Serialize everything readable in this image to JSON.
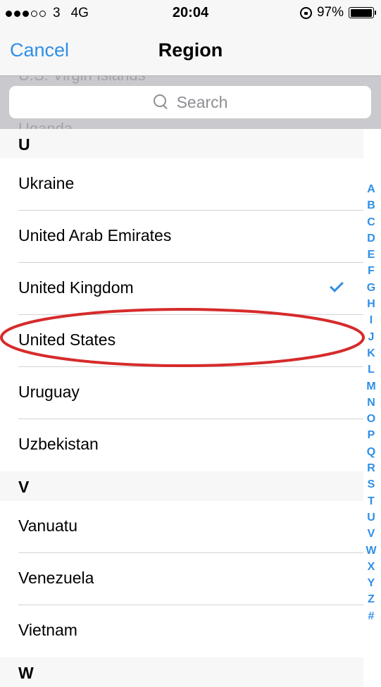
{
  "status_bar": {
    "carrier": "3",
    "network": "4G",
    "time": "20:04",
    "battery": "97%",
    "battery_level": 0.97,
    "signal": {
      "filled": 3,
      "total": 5
    }
  },
  "nav": {
    "cancel_label": "Cancel",
    "title": "Region"
  },
  "search": {
    "placeholder": "Search",
    "ghost_above": "U.S. Virgin Islands",
    "ghost_below": "Uganda"
  },
  "sections": [
    {
      "letter": "U",
      "items": [
        "Ukraine",
        "United Arab Emirates",
        "United Kingdom",
        "United States",
        "Uruguay",
        "Uzbekistan"
      ]
    },
    {
      "letter": "V",
      "items": [
        "Vanuatu",
        "Venezuela",
        "Vietnam"
      ]
    },
    {
      "letter": "W",
      "items": []
    }
  ],
  "selected": "United Kingdom",
  "highlighted": "United States",
  "index": [
    "A",
    "B",
    "C",
    "D",
    "E",
    "F",
    "G",
    "H",
    "I",
    "J",
    "K",
    "L",
    "M",
    "N",
    "O",
    "P",
    "Q",
    "R",
    "S",
    "T",
    "U",
    "V",
    "W",
    "X",
    "Y",
    "Z",
    "#"
  ],
  "colors": {
    "accent": "#2f8fe6",
    "annotation": "#d62b2b",
    "bar_background": "#f7f7f7",
    "search_background": "#c9c9ce"
  }
}
